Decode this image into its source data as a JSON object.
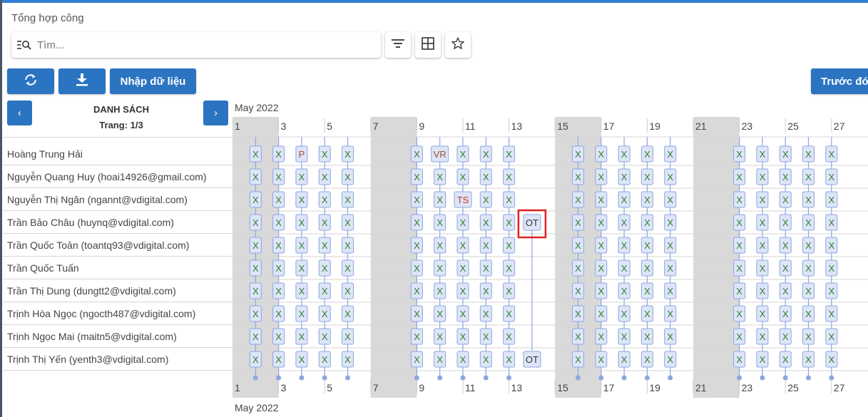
{
  "page": {
    "title": "Tổng hợp công"
  },
  "search": {
    "placeholder": "Tìm..."
  },
  "toolbar": {
    "filter_icon": "filter-icon",
    "grid_icon": "grid-view-icon",
    "star_icon": "star-icon",
    "refresh_icon": "refresh-icon",
    "download_icon": "download-icon",
    "import_label": "Nhập dữ liệu",
    "prev_label": "Trước đó"
  },
  "list": {
    "title": "DANH SÁCH",
    "page_label": "Trang: 1/3",
    "prev_arrow": "‹",
    "next_arrow": "›"
  },
  "employees": [
    "Hoàng Trung Hải",
    "Nguyễn Quang Huy (hoai14926@gmail.com)",
    "Nguyễn Thị Ngân (ngannt@vdigital.com)",
    "Trần Bảo Châu (huynq@vdigital.com)",
    "Trần Quốc Toản (toantq93@vdigital.com)",
    "Trần Quốc Tuấn",
    "Trần Thị Dung (dungtt2@vdigital.com)",
    "Trịnh Hòa Ngọc (ngocth487@vdigital.com)",
    "Trịnh Ngọc Mai (maitn5@vdigital.com)",
    "Trịnh Thị Yến (yenth3@vdigital.com)"
  ],
  "timeline": {
    "month_label": "May 2022",
    "day_labels": [
      "1",
      "3",
      "5",
      "7",
      "9",
      "11",
      "13",
      "15",
      "17",
      "19",
      "21",
      "23",
      "25",
      "27"
    ],
    "weekend_days": [
      1,
      7,
      15,
      21
    ],
    "day_count": 27
  },
  "attendance": [
    {
      "1": "X",
      "2": "X",
      "3": "P",
      "4": "X",
      "5": "X",
      "8": "X",
      "9": "VR",
      "10": "X",
      "11": "X",
      "12": "X",
      "15": "X",
      "16": "X",
      "17": "X",
      "18": "X",
      "19": "X",
      "22": "X",
      "23": "X",
      "24": "X",
      "25": "X",
      "26": "X"
    },
    {
      "1": "X",
      "2": "X",
      "3": "X",
      "4": "X",
      "5": "X",
      "8": "X",
      "9": "X",
      "10": "X",
      "11": "X",
      "12": "X",
      "15": "X",
      "16": "X",
      "17": "X",
      "18": "X",
      "19": "X",
      "22": "X",
      "23": "X",
      "24": "X",
      "25": "X",
      "26": "X"
    },
    {
      "1": "X",
      "2": "X",
      "3": "X",
      "4": "X",
      "5": "X",
      "8": "X",
      "9": "X",
      "10": "TS",
      "11": "X",
      "12": "X",
      "15": "X",
      "16": "X",
      "17": "X",
      "18": "X",
      "19": "X",
      "22": "X",
      "23": "X",
      "24": "X",
      "25": "X",
      "26": "X"
    },
    {
      "1": "X",
      "2": "X",
      "3": "X",
      "4": "X",
      "5": "X",
      "8": "X",
      "9": "X",
      "10": "X",
      "11": "X",
      "12": "X",
      "13": "OT",
      "15": "X",
      "16": "X",
      "17": "X",
      "18": "X",
      "19": "X",
      "22": "X",
      "23": "X",
      "24": "X",
      "25": "X",
      "26": "X"
    },
    {
      "1": "X",
      "2": "X",
      "3": "X",
      "4": "X",
      "5": "X",
      "8": "X",
      "9": "X",
      "10": "X",
      "11": "X",
      "12": "X",
      "15": "X",
      "16": "X",
      "17": "X",
      "18": "X",
      "19": "X",
      "22": "X",
      "23": "X",
      "24": "X",
      "25": "X",
      "26": "X"
    },
    {
      "1": "X",
      "2": "X",
      "3": "X",
      "4": "X",
      "5": "X",
      "8": "X",
      "9": "X",
      "10": "X",
      "11": "X",
      "12": "X",
      "15": "X",
      "16": "X",
      "17": "X",
      "18": "X",
      "19": "X",
      "22": "X",
      "23": "X",
      "24": "X",
      "25": "X",
      "26": "X"
    },
    {
      "1": "X",
      "2": "X",
      "3": "X",
      "4": "X",
      "5": "X",
      "8": "X",
      "9": "X",
      "10": "X",
      "11": "X",
      "12": "X",
      "15": "X",
      "16": "X",
      "17": "X",
      "18": "X",
      "19": "X",
      "22": "X",
      "23": "X",
      "24": "X",
      "25": "X",
      "26": "X"
    },
    {
      "1": "X",
      "2": "X",
      "3": "X",
      "4": "X",
      "5": "X",
      "8": "X",
      "9": "X",
      "10": "X",
      "11": "X",
      "12": "X",
      "15": "X",
      "16": "X",
      "17": "X",
      "18": "X",
      "19": "X",
      "22": "X",
      "23": "X",
      "24": "X",
      "25": "X",
      "26": "X"
    },
    {
      "1": "X",
      "2": "X",
      "3": "X",
      "4": "X",
      "5": "X",
      "8": "X",
      "9": "X",
      "10": "X",
      "11": "X",
      "12": "X",
      "15": "X",
      "16": "X",
      "17": "X",
      "18": "X",
      "19": "X",
      "22": "X",
      "23": "X",
      "24": "X",
      "25": "X",
      "26": "X"
    },
    {
      "1": "X",
      "2": "X",
      "3": "X",
      "4": "X",
      "5": "X",
      "8": "X",
      "9": "X",
      "10": "X",
      "11": "X",
      "12": "X",
      "13": "OT",
      "15": "X",
      "16": "X",
      "17": "X",
      "18": "X",
      "19": "X",
      "22": "X",
      "23": "X",
      "24": "X",
      "25": "X",
      "26": "X"
    }
  ],
  "highlight": {
    "employee_index": 3,
    "day": 13
  },
  "colors": {
    "brand": "#2b74c1",
    "weekend": "#d9d9d9",
    "cell_bg": "#dde5f7",
    "cell_border": "#8da6e0",
    "x_text": "#2e7d32",
    "leave_text": "#c0392b",
    "highlight": "#e02020"
  }
}
